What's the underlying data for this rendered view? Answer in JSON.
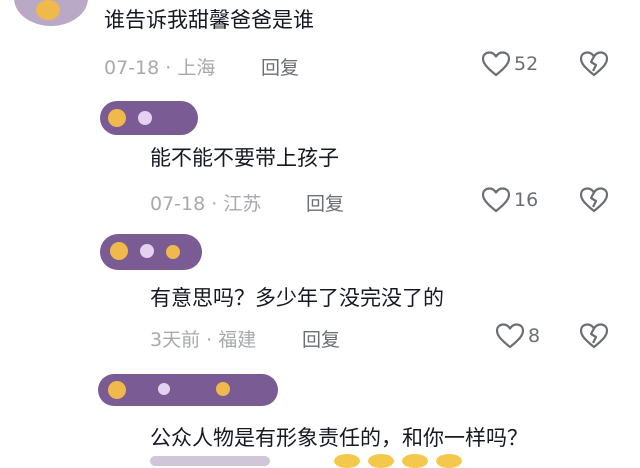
{
  "comments": [
    {
      "text": "谁告诉我甜馨爸爸是谁",
      "date": "07-18",
      "location": "上海",
      "reply_label": "回复",
      "likes": "52"
    },
    {
      "text": "能不能不要带上孩子",
      "date": "07-18",
      "location": "江苏",
      "reply_label": "回复",
      "likes": "16"
    },
    {
      "text": "有意思吗？多少年了没完没了的",
      "date": "3天前",
      "location": "福建",
      "reply_label": "回复",
      "likes": "8"
    },
    {
      "text": "公众人物是有形象责任的，和你一样吗？"
    }
  ],
  "separator": "·",
  "colors": {
    "text": "#161823",
    "meta": "#a7a9ad",
    "scribble": "#7b5b93",
    "icon": "#6b6e74"
  },
  "icons": [
    "heart-icon",
    "broken-heart-icon"
  ]
}
